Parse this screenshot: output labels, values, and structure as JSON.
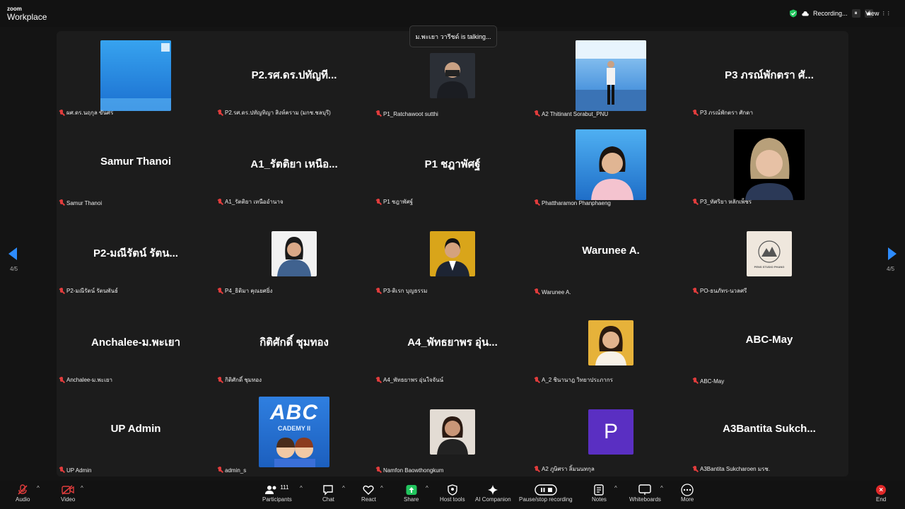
{
  "app": {
    "brand_line1": "zoom",
    "brand_line2": "Workplace"
  },
  "top": {
    "recording": "Recording...",
    "pause_icon": "⏸",
    "stop_icon": "■",
    "view": "View",
    "shield_icon": "shield-check",
    "view_icon": "⋮⋮"
  },
  "talking": "ม.พะเยา วารีชด์ is talking...",
  "pager": {
    "left": "4/5",
    "right": "4/5"
  },
  "tiles": [
    {
      "label": "ผศ.ดร.นฤกุล ขันศร"
    },
    {
      "name": "P2.รศ.ดร.ปทัญที...",
      "label": "P2.รศ.ดร.ปทัญทิญา สิงห์คราม (มกช.ชลบุรี)"
    },
    {
      "label": "P1_Ratchawoot sutthi"
    },
    {
      "label": "A2 Thitinant Sorabut_PNU"
    },
    {
      "name": "P3 ภรณ์พักตรา ศั...",
      "label": "P3 ภรณ์พักตรา ศักดา"
    },
    {
      "name": "Samur Thanoi",
      "label": "Samur Thanoi"
    },
    {
      "name": "A1_รัตติยา เหนือ...",
      "label": "A1_รัตติยา เหนืออำนาจ"
    },
    {
      "name": "P1 ชฎาพัศฐ์",
      "label": "P1 ชฎาพัศฐ์"
    },
    {
      "label": "Phattharamon Phanphaeng"
    },
    {
      "label": "P3_ทัศริยา หลักเพ็ชร"
    },
    {
      "name": "P2-มณีรัตน์ รัตน...",
      "label": "P2-มณีรัตน์ รัตนพันธ์"
    },
    {
      "label": "P4_ธิติมา คุณยศยิ่ง"
    },
    {
      "label": "P3-ดิเรก บุญธรรม"
    },
    {
      "name": "Warunee A.",
      "label": "Warunee A."
    },
    {
      "label": "PO-ธนภัทร-นวลศรี",
      "logo_text": "PENS STUDIO PHANG"
    },
    {
      "name": "Anchalee-ม.พะเยา",
      "label": "Anchalee-ม.พะเยา"
    },
    {
      "name": "กิติศักดิ์ ชุมทอง",
      "label": "กิติศักดิ์ ชุมทอง"
    },
    {
      "name": "A4_พัทธยาพร อุ่น...",
      "label": "A4_พัทธยาพร อุ่นใจจันน์"
    },
    {
      "label": "A_2 ชินานาฎ  วิทยาประภากร"
    },
    {
      "name": "ABC-May",
      "label": "ABC-May"
    },
    {
      "name": "UP Admin",
      "label": "UP Admin"
    },
    {
      "label": "admin_s",
      "logo_text": "ABC",
      "logo_sub": "CADEMY II"
    },
    {
      "label": "Namfon Baowthongkum"
    },
    {
      "label": "A2 ภูษิศรา ลิ้มนนทกุล",
      "avatar_letter": "P",
      "avatar_color": "#5a2fc2"
    },
    {
      "name": "A3Bantita  Sukch...",
      "label": "A3Bantita Sukcharoen มรช."
    }
  ],
  "toolbar": {
    "audio": "Audio",
    "video": "Video",
    "participants": "Participants",
    "participants_count": "111",
    "chat": "Chat",
    "react": "React",
    "share": "Share",
    "host_tools": "Host tools",
    "ai": "AI Companion",
    "record": "Pause/stop recording",
    "notes": "Notes",
    "whiteboards": "Whiteboards",
    "more": "More",
    "end": "End"
  },
  "colors": {
    "accent": "#2d8cff",
    "muted_red": "#e03c3c",
    "share_green": "#22c55e",
    "end_red": "#e02828"
  }
}
